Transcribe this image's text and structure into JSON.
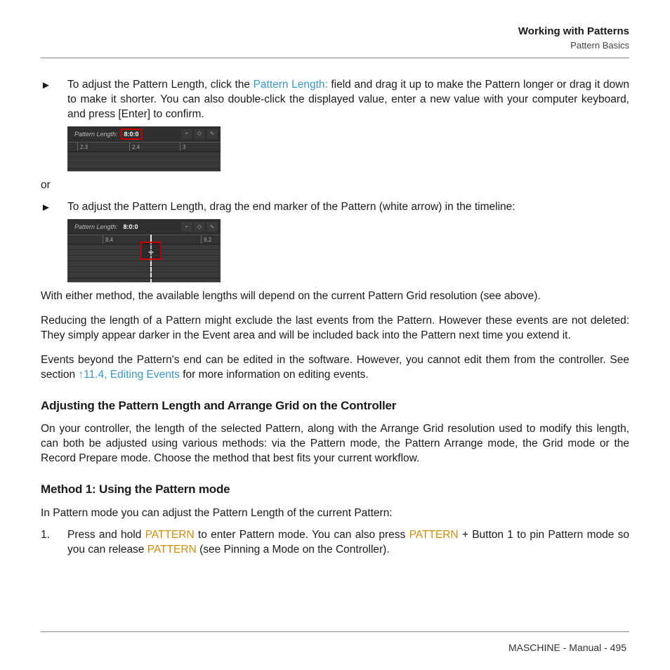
{
  "header": {
    "title": "Working with Patterns",
    "subtitle": "Pattern Basics"
  },
  "step1": {
    "marker": "►",
    "pre": "To adjust the Pattern Length, click the ",
    "link": "Pattern Length:",
    "post": " field and drag it up to make the Pattern longer or drag it down to make it shorter. You can also double-click the displayed value, enter a new value with your computer keyboard, and press [Enter] to confirm."
  },
  "shot1": {
    "label": "Pattern Length:",
    "value": "8:0:0",
    "ticks": [
      "2.3",
      "2.4",
      "3"
    ]
  },
  "or": "or",
  "step2": {
    "marker": "►",
    "text": "To adjust the Pattern Length, drag the end marker of the Pattern (white arrow) in the timeline:"
  },
  "shot2": {
    "label": "Pattern Length:",
    "value": "8:0:0",
    "ticks": [
      "8.4",
      "9.2"
    ]
  },
  "para1": "With either method, the available lengths will depend on the current Pattern Grid resolution (see above).",
  "para2": "Reducing the length of a Pattern might exclude the last events from the Pattern. However these events are not deleted: They simply appear darker in the Event area and will be included back into the Pattern next time you extend it.",
  "para3a": "Events beyond the Pattern's end can be edited in the software. However, you cannot edit them from the controller. See section ",
  "para3link": "↑11.4, Editing Events",
  "para3b": " for more information on editing events.",
  "h3a": "Adjusting the Pattern Length and Arrange Grid on the Controller",
  "para4": "On your controller, the length of the selected Pattern, along with the Arrange Grid resolution used to modify this length, can both be adjusted using various methods: via the Pattern mode, the Pattern Arrange mode, the Grid mode or the Record Prepare mode. Choose the method that best fits your current workflow.",
  "h3b": "Method 1: Using the Pattern mode",
  "para5": "In Pattern mode you can adjust the Pattern Length of the current Pattern:",
  "m1": {
    "num": "1.",
    "a": "Press and hold ",
    "k1": "PATTERN",
    "b": " to enter Pattern mode. You can also press ",
    "k2": "PATTERN",
    "c": " + Button 1 to pin Pattern mode so you can release ",
    "k3": "PATTERN",
    "d": " (see Pinning a Mode on the Controller)."
  },
  "footer": "MASCHINE - Manual - 495"
}
